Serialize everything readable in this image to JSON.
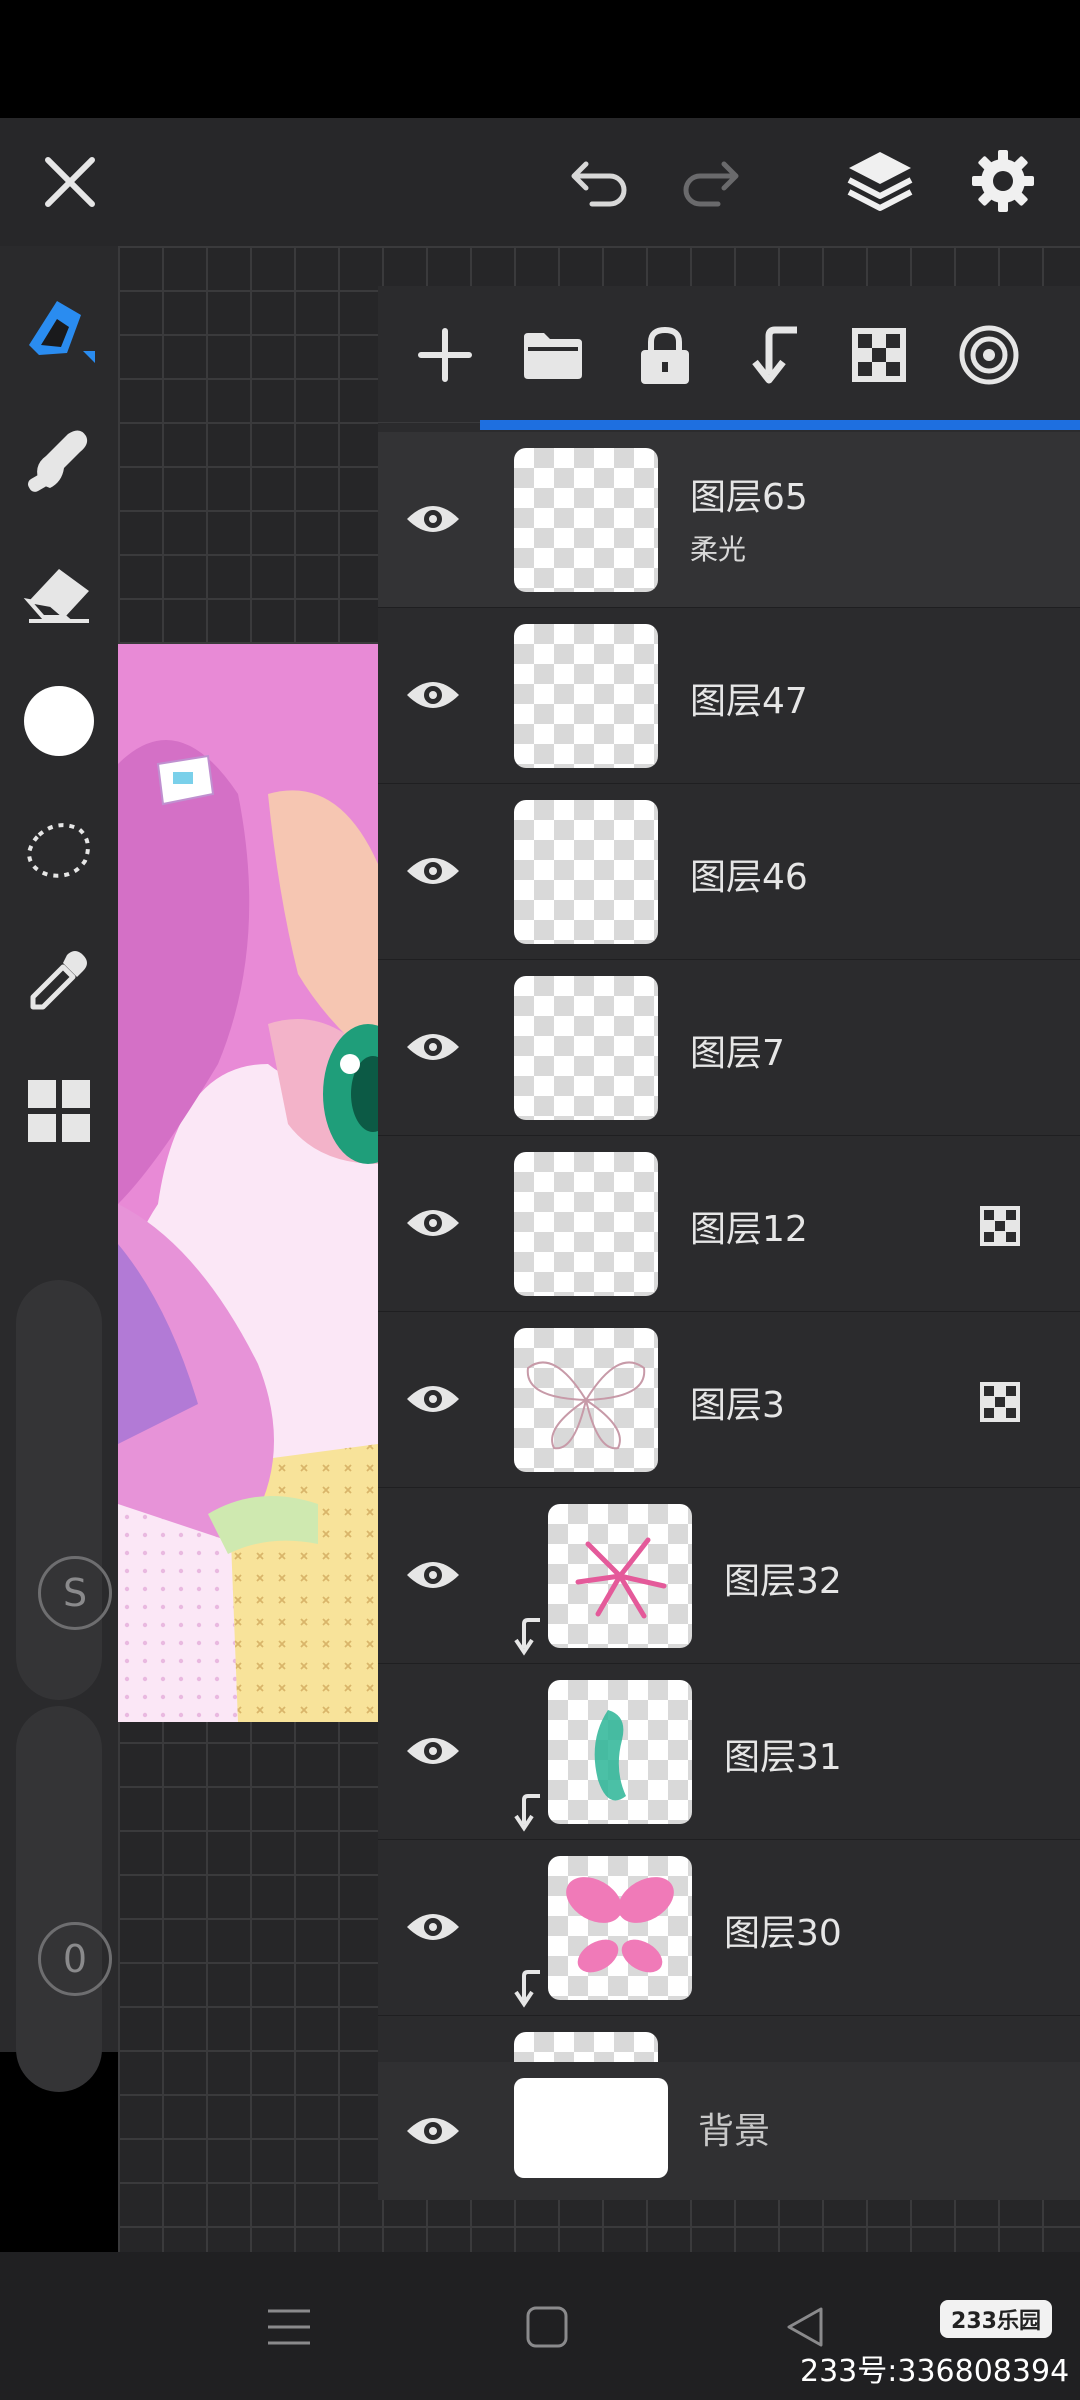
{
  "topbar": {
    "close_icon": "close-icon",
    "undo_icon": "undo-icon",
    "redo_icon": "redo-icon",
    "layers_icon": "layers-icon",
    "settings_icon": "gear-icon"
  },
  "tools": [
    "brush-icon",
    "smudge-icon",
    "eraser-icon",
    "color-swatch",
    "lasso-icon",
    "eyedropper-icon",
    "grid-menu-icon"
  ],
  "sliders": {
    "size_label": "S",
    "opacity_label": "0"
  },
  "layer_toolbar": [
    "add-icon",
    "folder-icon",
    "lock-icon",
    "clip-icon",
    "alpha-lock-icon",
    "blend-target-icon"
  ],
  "layers": [
    {
      "name": "图层65",
      "blend": "柔光",
      "clipped": false,
      "alpha": false
    },
    {
      "name": "图层47",
      "blend": "",
      "clipped": false,
      "alpha": false
    },
    {
      "name": "图层46",
      "blend": "",
      "clipped": false,
      "alpha": false
    },
    {
      "name": "图层7",
      "blend": "",
      "clipped": false,
      "alpha": false
    },
    {
      "name": "图层12",
      "blend": "",
      "clipped": false,
      "alpha": true
    },
    {
      "name": "图层3",
      "blend": "",
      "clipped": false,
      "alpha": true
    },
    {
      "name": "图层32",
      "blend": "",
      "clipped": true,
      "alpha": false
    },
    {
      "name": "图层31",
      "blend": "",
      "clipped": true,
      "alpha": false
    },
    {
      "name": "图层30",
      "blend": "",
      "clipped": true,
      "alpha": false
    }
  ],
  "background_layer": {
    "name": "背景"
  },
  "watermark": {
    "logo": "233乐园",
    "text": "233号:336808394"
  },
  "colors": {
    "accent": "#1e6fe0",
    "panel": "#2b2b2d",
    "brush_active": "#2a8cf0"
  }
}
